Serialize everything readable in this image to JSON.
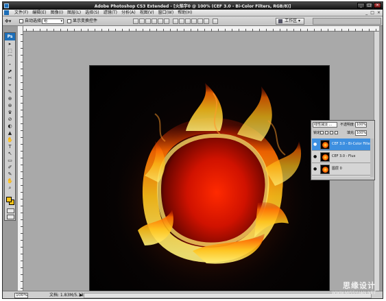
{
  "app": {
    "title": "Adobe Photoshop CS3 Extended - [火焰字0 @ 100% (CEF 3.0 - Bi-Color Filters, RGB/8)]",
    "window_buttons": [
      "_",
      "□",
      "×"
    ]
  },
  "menu": {
    "items": [
      "文件(F)",
      "编辑(E)",
      "图像(I)",
      "图层(L)",
      "选择(S)",
      "滤镜(T)",
      "分析(A)",
      "视图(V)",
      "窗口(W)",
      "帮助(H)"
    ],
    "window_controls": [
      "_",
      "□",
      "×"
    ]
  },
  "options": {
    "tool_icon": "move-tool-icon",
    "auto_select_label": "自动选择:",
    "auto_select_value": "组",
    "show_transform_label": "显示变换控件",
    "workspace_label": "工作区 ▾"
  },
  "toolbox": {
    "logo": "Ps",
    "tools": [
      "▸",
      "⬚",
      "⌒",
      "⬝",
      "⬈",
      "✂",
      "⌖",
      "✎",
      "⊕",
      "⊗",
      "♛",
      "⊘",
      "◐",
      "▲",
      "✋",
      "◔",
      "T",
      "↖",
      "▭",
      "✐",
      "✎",
      "✥",
      "⌕",
      "✋",
      "⊙"
    ],
    "foreground_color": "#f6c21a",
    "background_color": "#f6c21a"
  },
  "status": {
    "zoom": "100%",
    "doc_info": "文档: 1.83M/5.13M",
    "arrow": "▶"
  },
  "layers": {
    "blend_mode": "线性减淡 ...",
    "opacity_label": "不透明度:",
    "opacity_value": "100%",
    "lock_label": "锁定:",
    "fill_label": "填充:",
    "fill_value": "100%",
    "items": [
      {
        "name": "CEF 3.0 - Bi-Color Filters",
        "selected": true
      },
      {
        "name": "CEF 3.0 - Flux",
        "selected": false
      },
      {
        "name": "图层 0",
        "selected": false
      }
    ]
  },
  "watermark": {
    "title": "思缘设计",
    "url": "WWW.MISSYUAN.NET"
  },
  "colors": {
    "selection": "#3d8fe0",
    "fire_core": "#e01a00",
    "fire_edge": "#ffd23a"
  }
}
